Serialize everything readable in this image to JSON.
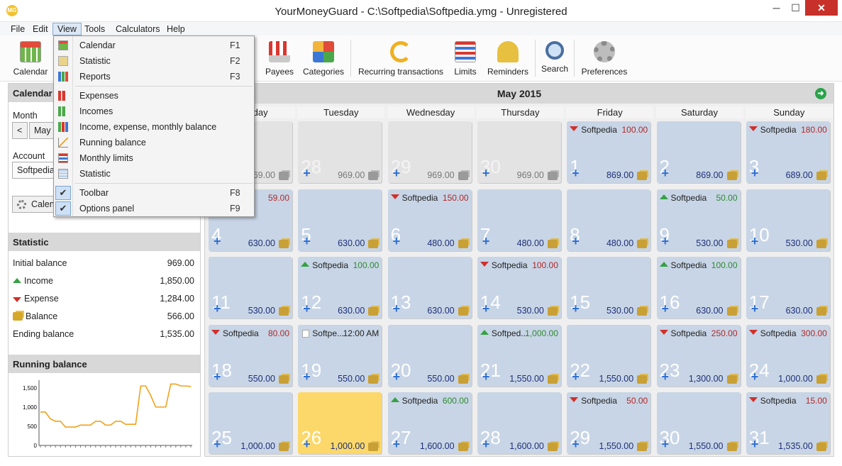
{
  "window": {
    "title": "YourMoneyGuard - C:\\Softpedia\\Softpedia.ymg - Unregistered",
    "app_icon": "MG",
    "min": "─",
    "max": "☐",
    "close": "✕"
  },
  "menubar": {
    "file": "File",
    "edit": "Edit",
    "view": "View",
    "tools": "Tools",
    "calculators": "Calculators",
    "help": "Help"
  },
  "toolbar": {
    "calendar": "Calendar",
    "payees": "Payees",
    "categories": "Categories",
    "recurring": "Recurring transactions",
    "limits": "Limits",
    "reminders": "Reminders",
    "search": "Search",
    "preferences": "Preferences"
  },
  "view_menu": {
    "calendar": {
      "label": "Calendar",
      "key": "F1"
    },
    "statistic": {
      "label": "Statistic",
      "key": "F2"
    },
    "reports": {
      "label": "Reports",
      "key": "F3"
    },
    "expenses": "Expenses",
    "incomes": "Incomes",
    "iemb": "Income, expense, monthly balance",
    "running": "Running balance",
    "monthly_limits": "Monthly limits",
    "statistic2": "Statistic",
    "toolbar": {
      "label": "Toolbar",
      "key": "F8"
    },
    "options_panel": {
      "label": "Options panel",
      "key": "F9"
    },
    "check": "✔"
  },
  "left": {
    "calendar_head": "Calendar",
    "month_label": "Month",
    "prev": "<",
    "month_value": "May",
    "account_label": "Account",
    "account_value": "Softpedia",
    "calen_btn": "Calendar",
    "statistic_head": "Statistic",
    "stats": {
      "initial": {
        "label": "Initial balance",
        "value": "969.00"
      },
      "income": {
        "label": "Income",
        "value": "1,850.00"
      },
      "expense": {
        "label": "Expense",
        "value": "1,284.00"
      },
      "balance": {
        "label": "Balance",
        "value": "566.00"
      },
      "ending": {
        "label": "Ending balance",
        "value": "1,535.00"
      }
    },
    "running_head": "Running balance"
  },
  "chart_data": {
    "type": "line",
    "y_ticks": [
      "1,500",
      "1,000",
      "500",
      "0"
    ],
    "ylim": [
      0,
      1700
    ],
    "x": [
      1,
      2,
      3,
      4,
      5,
      6,
      7,
      8,
      9,
      10,
      11,
      12,
      13,
      14,
      15,
      16,
      17,
      18,
      19,
      20,
      21,
      22,
      23,
      24,
      25,
      26,
      27,
      28,
      29,
      30,
      31
    ],
    "values": [
      869,
      869,
      689,
      630,
      630,
      480,
      480,
      480,
      530,
      530,
      530,
      630,
      630,
      530,
      530,
      630,
      630,
      550,
      550,
      550,
      1550,
      1550,
      1300,
      1000,
      1000,
      1000,
      1600,
      1600,
      1550,
      1550,
      1535
    ],
    "color": "#f0a21a"
  },
  "calendar": {
    "title": "May 2015",
    "next": "➜",
    "days": [
      "Monday",
      "Tuesday",
      "Wednesday",
      "Thursday",
      "Friday",
      "Saturday",
      "Sunday"
    ],
    "cells": [
      {
        "day": "",
        "bal": "969.00",
        "type": "oth"
      },
      {
        "day": "28",
        "bal": "969.00",
        "type": "oth"
      },
      {
        "day": "29",
        "bal": "969.00",
        "type": "oth"
      },
      {
        "day": "30",
        "bal": "969.00",
        "type": "oth"
      },
      {
        "day": "1",
        "bal": "869.00",
        "type": "cur",
        "tx": {
          "name": "Softpedia",
          "amt": "100.00",
          "dir": "out"
        }
      },
      {
        "day": "2",
        "bal": "869.00",
        "type": "cur"
      },
      {
        "day": "3",
        "bal": "689.00",
        "type": "cur",
        "tx": {
          "name": "Softpedia",
          "amt": "180.00",
          "dir": "out"
        }
      },
      {
        "day": "4",
        "bal": "630.00",
        "type": "cur",
        "tx": {
          "name": "a",
          "amt": "59.00",
          "dir": "out"
        }
      },
      {
        "day": "5",
        "bal": "630.00",
        "type": "cur"
      },
      {
        "day": "6",
        "bal": "480.00",
        "type": "cur",
        "tx": {
          "name": "Softpedia",
          "amt": "150.00",
          "dir": "out"
        }
      },
      {
        "day": "7",
        "bal": "480.00",
        "type": "cur"
      },
      {
        "day": "8",
        "bal": "480.00",
        "type": "cur"
      },
      {
        "day": "9",
        "bal": "530.00",
        "type": "cur",
        "tx": {
          "name": "Softpedia",
          "amt": "50.00",
          "dir": "in"
        }
      },
      {
        "day": "10",
        "bal": "530.00",
        "type": "cur"
      },
      {
        "day": "11",
        "bal": "530.00",
        "type": "cur"
      },
      {
        "day": "12",
        "bal": "630.00",
        "type": "cur",
        "tx": {
          "name": "Softpedia",
          "amt": "100.00",
          "dir": "in"
        }
      },
      {
        "day": "13",
        "bal": "630.00",
        "type": "cur"
      },
      {
        "day": "14",
        "bal": "530.00",
        "type": "cur",
        "tx": {
          "name": "Softpedia",
          "amt": "100.00",
          "dir": "out"
        }
      },
      {
        "day": "15",
        "bal": "530.00",
        "type": "cur"
      },
      {
        "day": "16",
        "bal": "630.00",
        "type": "cur",
        "tx": {
          "name": "Softpedia",
          "amt": "100.00",
          "dir": "in"
        }
      },
      {
        "day": "17",
        "bal": "630.00",
        "type": "cur"
      },
      {
        "day": "18",
        "bal": "550.00",
        "type": "cur",
        "tx": {
          "name": "Softpedia",
          "amt": "80.00",
          "dir": "out"
        }
      },
      {
        "day": "19",
        "bal": "550.00",
        "type": "cur",
        "tx": {
          "name": "Softpe...",
          "amt": "12:00 AM",
          "dir": "note"
        }
      },
      {
        "day": "20",
        "bal": "550.00",
        "type": "cur"
      },
      {
        "day": "21",
        "bal": "1,550.00",
        "type": "cur",
        "tx": {
          "name": "Softped...",
          "amt": "1,000.00",
          "dir": "in"
        }
      },
      {
        "day": "22",
        "bal": "1,550.00",
        "type": "cur"
      },
      {
        "day": "23",
        "bal": "1,300.00",
        "type": "cur",
        "tx": {
          "name": "Softpedia",
          "amt": "250.00",
          "dir": "out"
        }
      },
      {
        "day": "24",
        "bal": "1,000.00",
        "type": "cur",
        "tx": {
          "name": "Softpedia",
          "amt": "300.00",
          "dir": "out"
        }
      },
      {
        "day": "25",
        "bal": "1,000.00",
        "type": "cur"
      },
      {
        "day": "26",
        "bal": "1,000.00",
        "type": "today"
      },
      {
        "day": "27",
        "bal": "1,600.00",
        "type": "cur",
        "tx": {
          "name": "Softpedia",
          "amt": "600.00",
          "dir": "in"
        }
      },
      {
        "day": "28",
        "bal": "1,600.00",
        "type": "cur"
      },
      {
        "day": "29",
        "bal": "1,550.00",
        "type": "cur",
        "tx": {
          "name": "Softpedia",
          "amt": "50.00",
          "dir": "out"
        }
      },
      {
        "day": "30",
        "bal": "1,550.00",
        "type": "cur"
      },
      {
        "day": "31",
        "bal": "1,535.00",
        "type": "cur",
        "tx": {
          "name": "Softpedia",
          "amt": "15.00",
          "dir": "out"
        }
      }
    ]
  },
  "colors": {
    "accent": "#2f6fd1",
    "cell": "#c8d5e6",
    "today": "#fcd86a",
    "income": "#35a243",
    "expense": "#d0302a"
  }
}
